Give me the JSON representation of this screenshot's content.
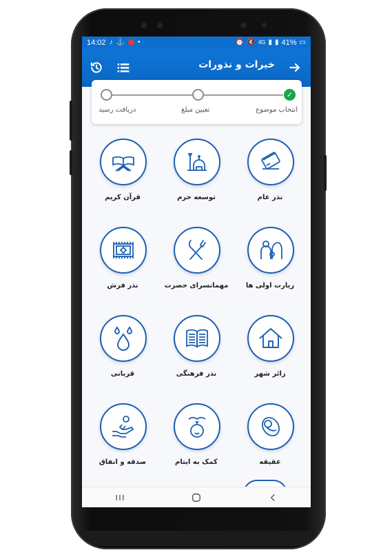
{
  "status_bar": {
    "time": "14:02",
    "network": "4G",
    "battery": "41%"
  },
  "app_bar": {
    "title": "خیرات و نذورات"
  },
  "stepper": {
    "steps": [
      {
        "label": "انتخاب موضوع",
        "state": "done"
      },
      {
        "label": "تعیین مبلغ",
        "state": "pending"
      },
      {
        "label": "دریافت رسید",
        "state": "pending"
      }
    ]
  },
  "categories": [
    {
      "label": "نذر عام",
      "icon": "card-icon"
    },
    {
      "label": "توسعه حرم",
      "icon": "shrine-icon"
    },
    {
      "label": "قرآن کریم",
      "icon": "quran-icon"
    },
    {
      "label": "زیارت اولی ها",
      "icon": "family-icon"
    },
    {
      "label": "مهمانسرای حضرت",
      "icon": "cutlery-icon"
    },
    {
      "label": "نذر فرش",
      "icon": "carpet-icon"
    },
    {
      "label": "زائر شهر",
      "icon": "house-icon"
    },
    {
      "label": "نذر فرهنگی",
      "icon": "book-icon"
    },
    {
      "label": "قربانی",
      "icon": "drops-icon"
    },
    {
      "label": "عقیقه",
      "icon": "baby-icon"
    },
    {
      "label": "کمک به ایتام",
      "icon": "child-care-icon"
    },
    {
      "label": "صدقه و انفاق",
      "icon": "charity-hand-icon"
    }
  ],
  "colors": {
    "primary": "#0d6fd0",
    "icon_stroke": "#1b5fb3",
    "done_green": "#1aa64a"
  }
}
